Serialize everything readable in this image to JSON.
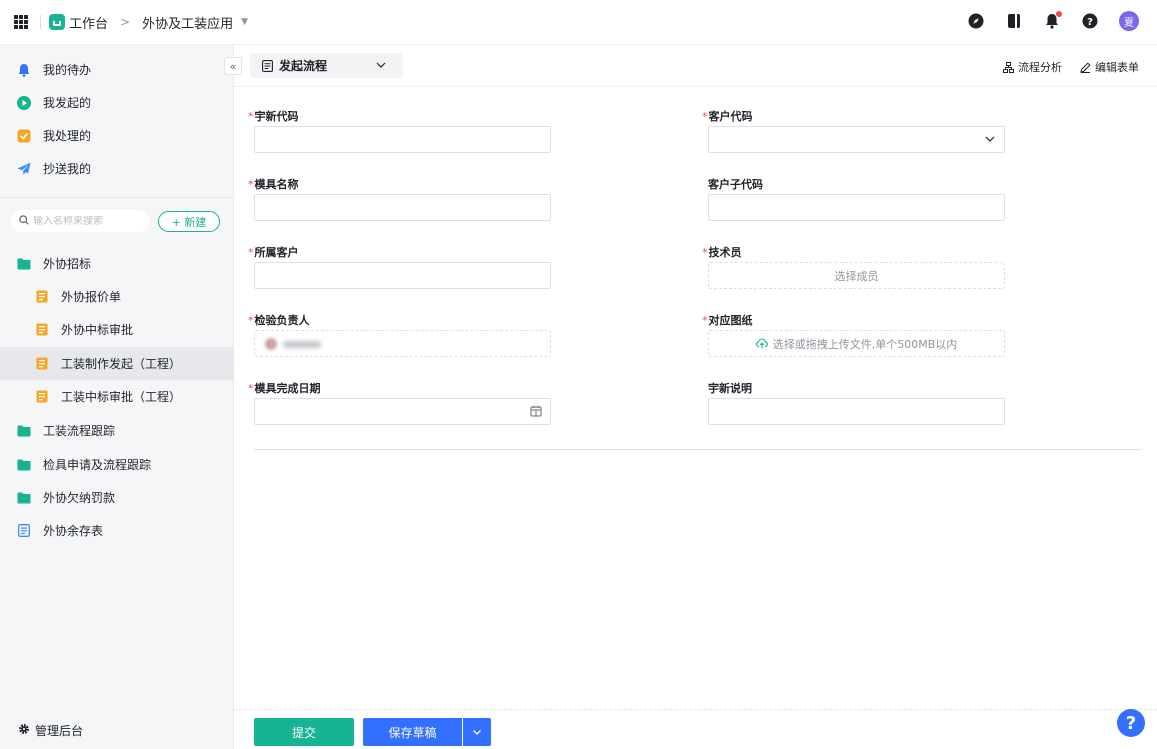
{
  "header": {
    "app_name": "工作台",
    "breadcrumb_sep": ">",
    "app_title": "外协及工装应用",
    "avatar_text": "夏"
  },
  "sidebar": {
    "collapse_glyph": "«",
    "quick": [
      {
        "label": "我的待办",
        "icon": "bell-icon"
      },
      {
        "label": "我发起的",
        "icon": "play-icon"
      },
      {
        "label": "我处理的",
        "icon": "check-icon"
      },
      {
        "label": "抄送我的",
        "icon": "send-icon"
      }
    ],
    "search_placeholder": "输入名称来搜索",
    "new_button": "+ 新建",
    "groups": [
      {
        "label": "外协招标",
        "icon": "folder-icon"
      },
      {
        "label": "外协报价单",
        "icon": "form-icon"
      },
      {
        "label": "外协中标审批",
        "icon": "form-icon"
      },
      {
        "label": "工装制作发起（工程）",
        "icon": "form-icon",
        "active": true
      },
      {
        "label": "工装中标审批（工程）",
        "icon": "form-icon"
      },
      {
        "label": "工装流程跟踪",
        "icon": "folder-icon"
      },
      {
        "label": "检具申请及流程跟踪",
        "icon": "folder-icon"
      },
      {
        "label": "外协欠纳罚款",
        "icon": "folder-icon"
      },
      {
        "label": "外协余存表",
        "icon": "report-icon"
      }
    ],
    "admin": "管理后台"
  },
  "toolbar": {
    "flow_label": "发起流程",
    "analysis": "流程分析",
    "edit_form": "编辑表单"
  },
  "form": {
    "required_mark": "*",
    "yuxin_code": {
      "label": "宇新代码",
      "required": true,
      "value": ""
    },
    "customer_code": {
      "label": "客户代码",
      "required": true,
      "value": ""
    },
    "mold_name": {
      "label": "模具名称",
      "required": true,
      "value": ""
    },
    "customer_sub_code": {
      "label": "客户子代码",
      "required": false,
      "value": ""
    },
    "customer": {
      "label": "所属客户",
      "required": true,
      "value": ""
    },
    "technician": {
      "label": "技术员",
      "required": true,
      "placeholder": "选择成员"
    },
    "inspector": {
      "label": "检验负责人",
      "required": true
    },
    "drawing": {
      "label": "对应图纸",
      "required": true,
      "placeholder": "选择或拖拽上传文件,单个500MB以内"
    },
    "finish_date": {
      "label": "模具完成日期",
      "required": true,
      "value": ""
    },
    "yuxin_desc": {
      "label": "宇新说明",
      "required": false,
      "value": ""
    }
  },
  "actions": {
    "submit": "提交",
    "save_draft": "保存草稿"
  },
  "help_glyph": "?",
  "colors": {
    "brand_green": "#17b392",
    "primary_blue": "#3370ff",
    "required_red": "#f54a45"
  }
}
